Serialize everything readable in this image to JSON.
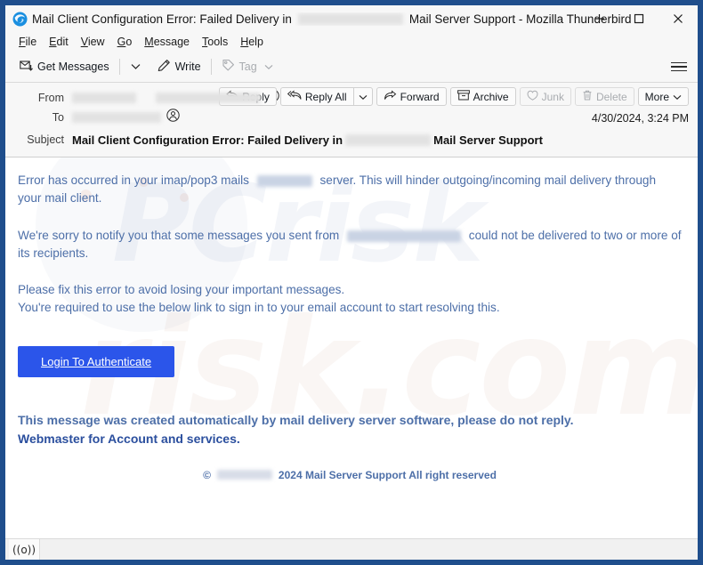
{
  "window": {
    "title_prefix": "Mail Client Configuration Error: Failed Delivery in",
    "title_suffix": "Mail Server Support - Mozilla Thunderbird",
    "app_icon": "thunderbird-icon",
    "minimize_label": "─",
    "maximize_label": "□",
    "close_label": "✕",
    "border_color": "#1f4e8c"
  },
  "menubar": {
    "items": [
      {
        "accesskey": "F",
        "rest": "ile"
      },
      {
        "accesskey": "E",
        "rest": "dit"
      },
      {
        "accesskey": "V",
        "rest": "iew"
      },
      {
        "accesskey": "G",
        "rest": "o"
      },
      {
        "accesskey": "M",
        "rest": "essage"
      },
      {
        "accesskey": "T",
        "rest": "ools"
      },
      {
        "accesskey": "H",
        "rest": "elp"
      }
    ]
  },
  "toolbar": {
    "get_messages_label": "Get Messages",
    "write_label": "Write",
    "tag_label": "Tag",
    "menu_icon": "hamburger-icon"
  },
  "message_header": {
    "from_label": "From",
    "to_label": "To",
    "subject_label": "Subject",
    "date": "4/30/2024, 3:24 PM",
    "subject_prefix": "Mail Client Configuration Error: Failed Delivery in",
    "subject_suffix": "Mail Server Support",
    "actions": {
      "reply": "Reply",
      "reply_all": "Reply All",
      "forward": "Forward",
      "archive": "Archive",
      "junk": "Junk",
      "delete": "Delete",
      "more": "More"
    }
  },
  "body": {
    "p1_before": "Error has occurred in your imap/pop3 mails",
    "p1_after": "server. This will hinder outgoing/incoming mail delivery through your mail client.",
    "p2_before": "We're sorry to notify you that some messages you sent from",
    "p2_after": "could not be delivered to two or more of its recipients.",
    "p3_line1": "Please fix this error to avoid losing your important messages.",
    "p3_line2": "You're required to use the below link to sign in to your email account to start resolving this.",
    "login_button": "Login To Authenticate",
    "closing_line1": "This message was created automatically by mail delivery server software, please do not reply.",
    "closing_line2": "Webmaster for Account and services.",
    "copyright_symbol": "©",
    "copyright_text": "2024 Mail Server Support All right reserved",
    "text_color": "#4d6fa8",
    "accent_color": "#2b55ea"
  },
  "statusbar": {
    "icon": "broadcast-icon",
    "icon_glyph": "((o))"
  }
}
